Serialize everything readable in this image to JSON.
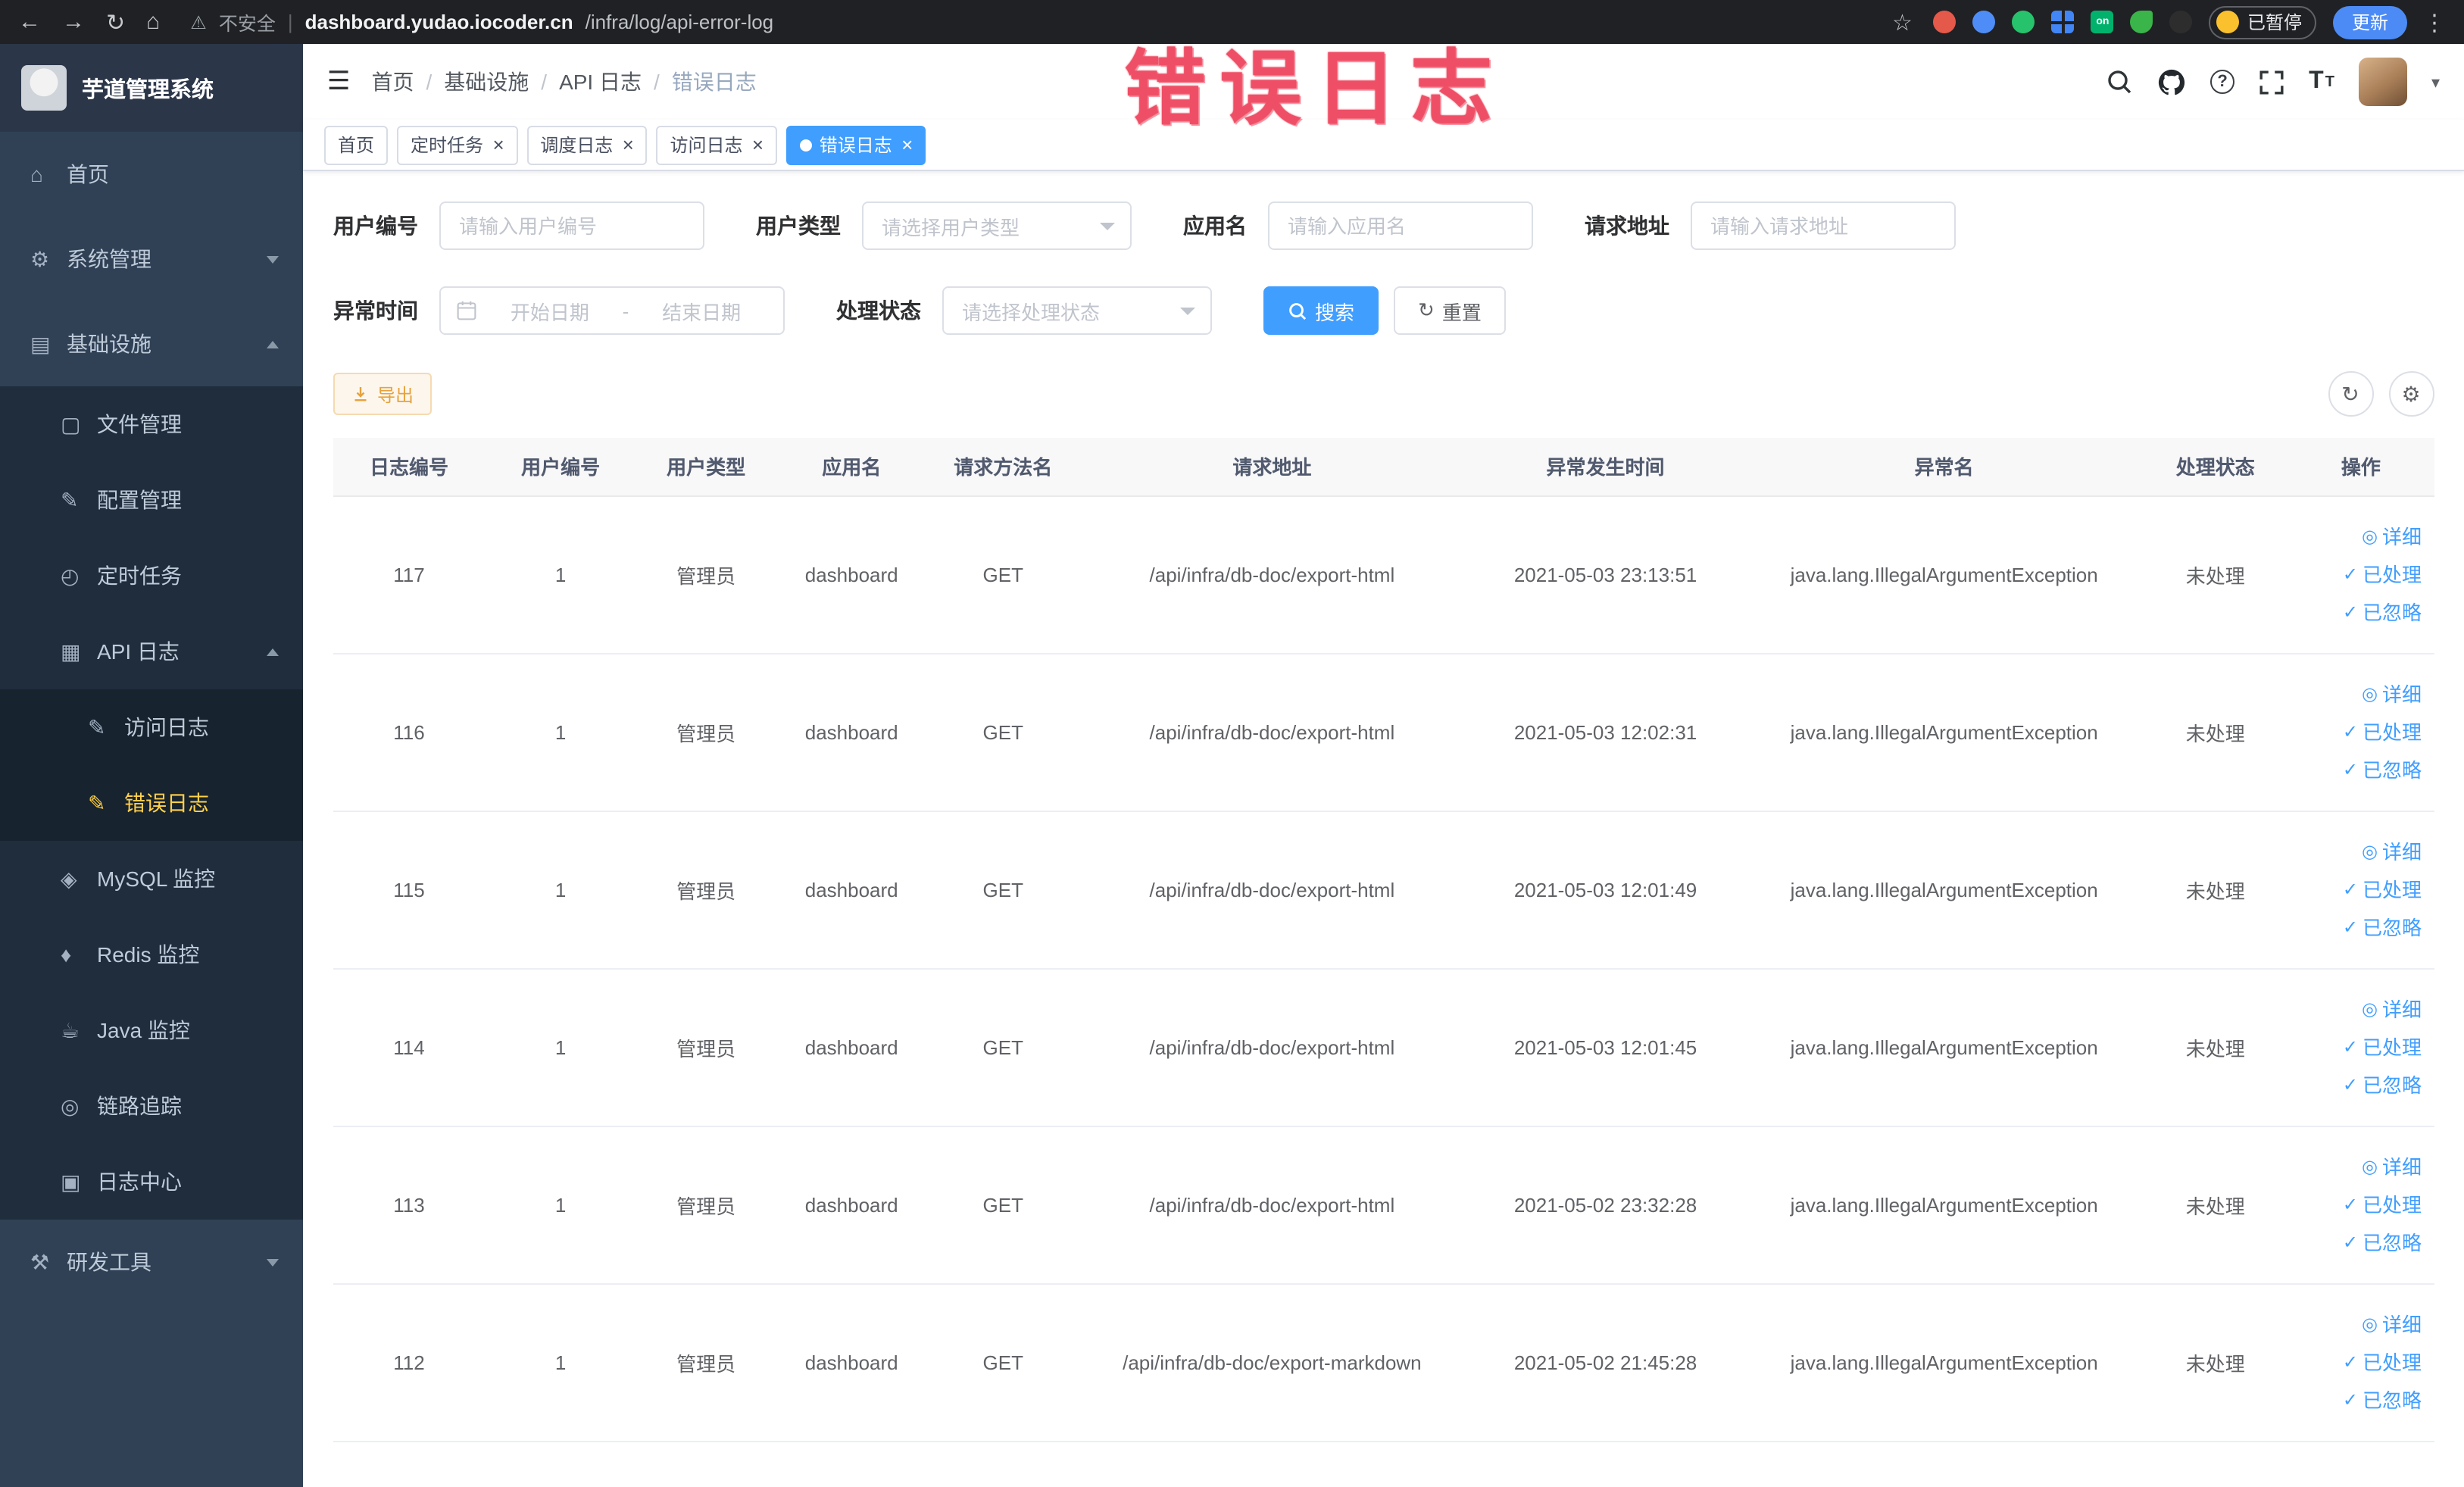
{
  "browser": {
    "insecure_label": "不安全",
    "url_domain": "dashboard.yudao.iocoder.cn",
    "url_path": "/infra/log/api-error-log",
    "paused_badge": "已暂停",
    "update_button": "更新"
  },
  "annotation": {
    "text": "错误日志"
  },
  "icons": {
    "back": "←",
    "forward": "→",
    "reload": "↻",
    "home": "⌂",
    "warning": "⚠",
    "star": "☆",
    "kebab": "⋮",
    "hamburger": "☰",
    "close": "×",
    "caret": "▾",
    "separator": "/",
    "view": "◎",
    "check": "✓",
    "refresh": "↻",
    "settings": "⚙",
    "on_badge": "on",
    "textsize": "T",
    "system": "⚙",
    "infra": "▤",
    "file": "▢",
    "config": "✎",
    "job": "◴",
    "apilog": "▦",
    "accesslog": "✎",
    "errorlog": "✎",
    "mysql": "◈",
    "redis": "♦",
    "java": "☕",
    "trace": "◎",
    "logcenter": "▣",
    "tools": "⚒"
  },
  "sidebar": {
    "logo_title": "芋道管理系统",
    "items": [
      {
        "label": "首页",
        "icon": "home",
        "level": 0
      },
      {
        "label": "系统管理",
        "icon": "system",
        "level": 0,
        "arrow": "down"
      },
      {
        "label": "基础设施",
        "icon": "infra",
        "level": 0,
        "arrow": "up"
      },
      {
        "label": "文件管理",
        "icon": "file",
        "level": 1
      },
      {
        "label": "配置管理",
        "icon": "config",
        "level": 1
      },
      {
        "label": "定时任务",
        "icon": "job",
        "level": 1
      },
      {
        "label": "API 日志",
        "icon": "apilog",
        "level": 1,
        "arrow": "up"
      },
      {
        "label": "访问日志",
        "icon": "accesslog",
        "level": 2
      },
      {
        "label": "错误日志",
        "icon": "errorlog",
        "level": 2,
        "active": true
      },
      {
        "label": "MySQL 监控",
        "icon": "mysql",
        "level": 1
      },
      {
        "label": "Redis 监控",
        "icon": "redis",
        "level": 1
      },
      {
        "label": "Java 监控",
        "icon": "java",
        "level": 1
      },
      {
        "label": "链路追踪",
        "icon": "trace",
        "level": 1
      },
      {
        "label": "日志中心",
        "icon": "logcenter",
        "level": 1
      },
      {
        "label": "研发工具",
        "icon": "tools",
        "level": 0,
        "arrow": "down"
      }
    ]
  },
  "header": {
    "breadcrumb": [
      {
        "label": "首页"
      },
      {
        "label": "基础设施"
      },
      {
        "label": "API 日志"
      },
      {
        "label": "错误日志",
        "current": true
      }
    ]
  },
  "tabs": [
    {
      "label": "首页"
    },
    {
      "label": "定时任务",
      "closable": true
    },
    {
      "label": "调度日志",
      "closable": true
    },
    {
      "label": "访问日志",
      "closable": true
    },
    {
      "label": "错误日志",
      "closable": true,
      "active": true
    }
  ],
  "filters": {
    "user_id": {
      "label": "用户编号",
      "placeholder": "请输入用户编号"
    },
    "user_type": {
      "label": "用户类型",
      "placeholder": "请选择用户类型"
    },
    "app_name": {
      "label": "应用名",
      "placeholder": "请输入应用名"
    },
    "request_url": {
      "label": "请求地址",
      "placeholder": "请输入请求地址"
    },
    "exception_time": {
      "label": "异常时间",
      "start_placeholder": "开始日期",
      "separator": "-",
      "end_placeholder": "结束日期"
    },
    "process_status": {
      "label": "处理状态",
      "placeholder": "请选择处理状态"
    },
    "search_button": "搜索",
    "reset_button": "重置"
  },
  "toolbar": {
    "export_button": "导出"
  },
  "table": {
    "columns": [
      "日志编号",
      "用户编号",
      "用户类型",
      "应用名",
      "请求方法名",
      "请求地址",
      "异常发生时间",
      "异常名",
      "处理状态",
      "操作"
    ],
    "actions": {
      "detail": "详细",
      "processed": "已处理",
      "ignored": "已忽略"
    },
    "rows": [
      {
        "id": "117",
        "user_id": "1",
        "user_type": "管理员",
        "app": "dashboard",
        "method": "GET",
        "url": "/api/infra/db-doc/export-html",
        "time": "2021-05-03 23:13:51",
        "exception": "java.lang.IllegalArgumentException",
        "status": "未处理"
      },
      {
        "id": "116",
        "user_id": "1",
        "user_type": "管理员",
        "app": "dashboard",
        "method": "GET",
        "url": "/api/infra/db-doc/export-html",
        "time": "2021-05-03 12:02:31",
        "exception": "java.lang.IllegalArgumentException",
        "status": "未处理"
      },
      {
        "id": "115",
        "user_id": "1",
        "user_type": "管理员",
        "app": "dashboard",
        "method": "GET",
        "url": "/api/infra/db-doc/export-html",
        "time": "2021-05-03 12:01:49",
        "exception": "java.lang.IllegalArgumentException",
        "status": "未处理"
      },
      {
        "id": "114",
        "user_id": "1",
        "user_type": "管理员",
        "app": "dashboard",
        "method": "GET",
        "url": "/api/infra/db-doc/export-html",
        "time": "2021-05-03 12:01:45",
        "exception": "java.lang.IllegalArgumentException",
        "status": "未处理"
      },
      {
        "id": "113",
        "user_id": "1",
        "user_type": "管理员",
        "app": "dashboard",
        "method": "GET",
        "url": "/api/infra/db-doc/export-html",
        "time": "2021-05-02 23:32:28",
        "exception": "java.lang.IllegalArgumentException",
        "status": "未处理"
      },
      {
        "id": "112",
        "user_id": "1",
        "user_type": "管理员",
        "app": "dashboard",
        "method": "GET",
        "url": "/api/infra/db-doc/export-markdown",
        "time": "2021-05-02 21:45:28",
        "exception": "java.lang.IllegalArgumentException",
        "status": "未处理"
      }
    ]
  }
}
